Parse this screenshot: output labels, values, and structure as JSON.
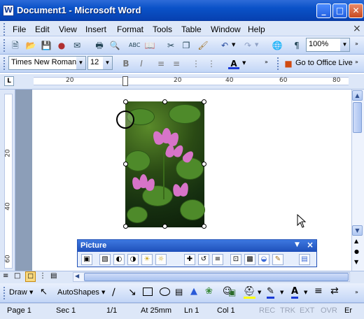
{
  "window": {
    "title": "Document1 - Microsoft Word",
    "app_icon": "W"
  },
  "menu": [
    "File",
    "Edit",
    "View",
    "Insert",
    "Format",
    "Tools",
    "Table",
    "Window",
    "Help"
  ],
  "standard_toolbar": {
    "zoom": "100%"
  },
  "formatting_toolbar": {
    "font": "Times New Roman",
    "size": "12",
    "office_live": "Go to Office Live"
  },
  "ruler": {
    "h_labels": [
      "20",
      "20",
      "40",
      "60",
      "80"
    ],
    "v_labels": [
      "20",
      "40",
      "60"
    ]
  },
  "picture_toolbar": {
    "title": "Picture"
  },
  "drawing_toolbar": {
    "draw": "Draw",
    "autoshapes": "AutoShapes"
  },
  "status": {
    "page": "Page 1",
    "sec": "Sec 1",
    "pages": "1/1",
    "at": "At 25mm",
    "ln": "Ln 1",
    "col": "Col 1",
    "rec": "REC",
    "trk": "TRK",
    "ext": "EXT",
    "ovr": "OVR",
    "lang": "Er"
  }
}
